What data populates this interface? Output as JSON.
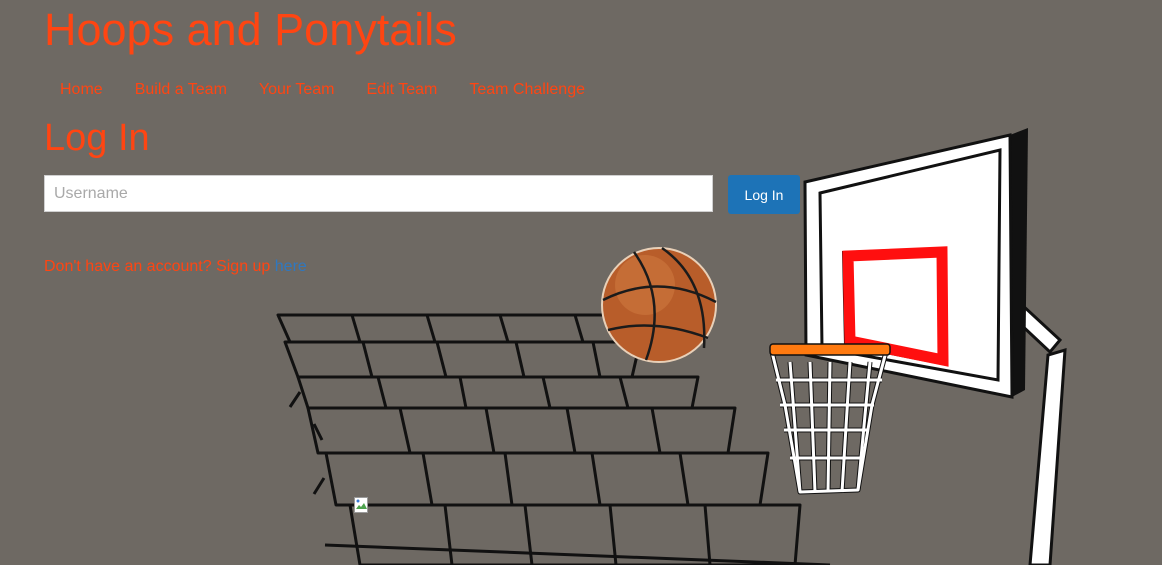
{
  "site": {
    "title": "Hoops and Ponytails"
  },
  "nav": {
    "items": [
      "Home",
      "Build a Team",
      "Your Team",
      "Edit Team",
      "Team Challenge"
    ]
  },
  "login": {
    "heading": "Log In",
    "username_placeholder": "Username",
    "username_value": "",
    "submit_label": "Log In",
    "signup_prompt": "Don't have an account? Sign up ",
    "signup_link": "here"
  },
  "icons": {
    "image": "broken-image-icon"
  },
  "colors": {
    "accent": "#ff4512",
    "background": "#6e6963",
    "button": "#1d73b7",
    "link": "#2f78c0"
  }
}
